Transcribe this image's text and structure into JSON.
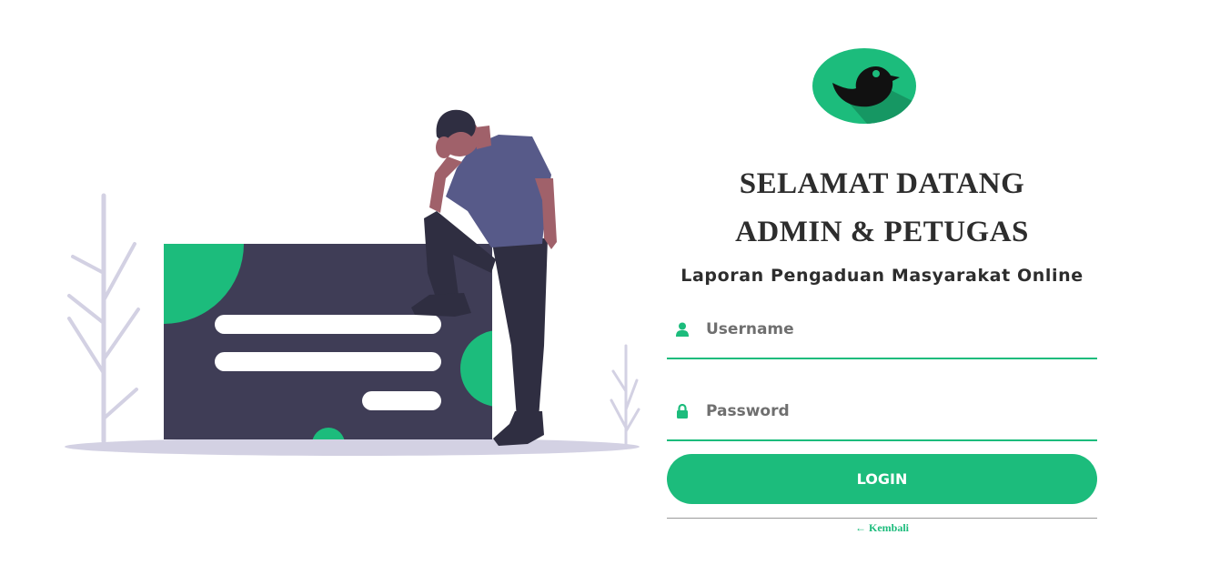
{
  "header": {
    "title_line1": "SELAMAT DATANG",
    "title_line2": "ADMIN & PETUGAS",
    "subtitle": "Laporan Pengaduan Masyarakat Online"
  },
  "form": {
    "username_placeholder": "Username",
    "username_value": "",
    "username_icon": "user-icon",
    "password_placeholder": "Password",
    "password_value": "",
    "password_icon": "lock-icon",
    "login_label": "LOGIN"
  },
  "footer": {
    "back_label": "Kembali",
    "back_icon": "arrow-left-icon"
  },
  "colors": {
    "accent": "#1cbc7c",
    "text": "#2d2d2d",
    "card": "#3f3d56",
    "ground": "#d3d1e3"
  }
}
